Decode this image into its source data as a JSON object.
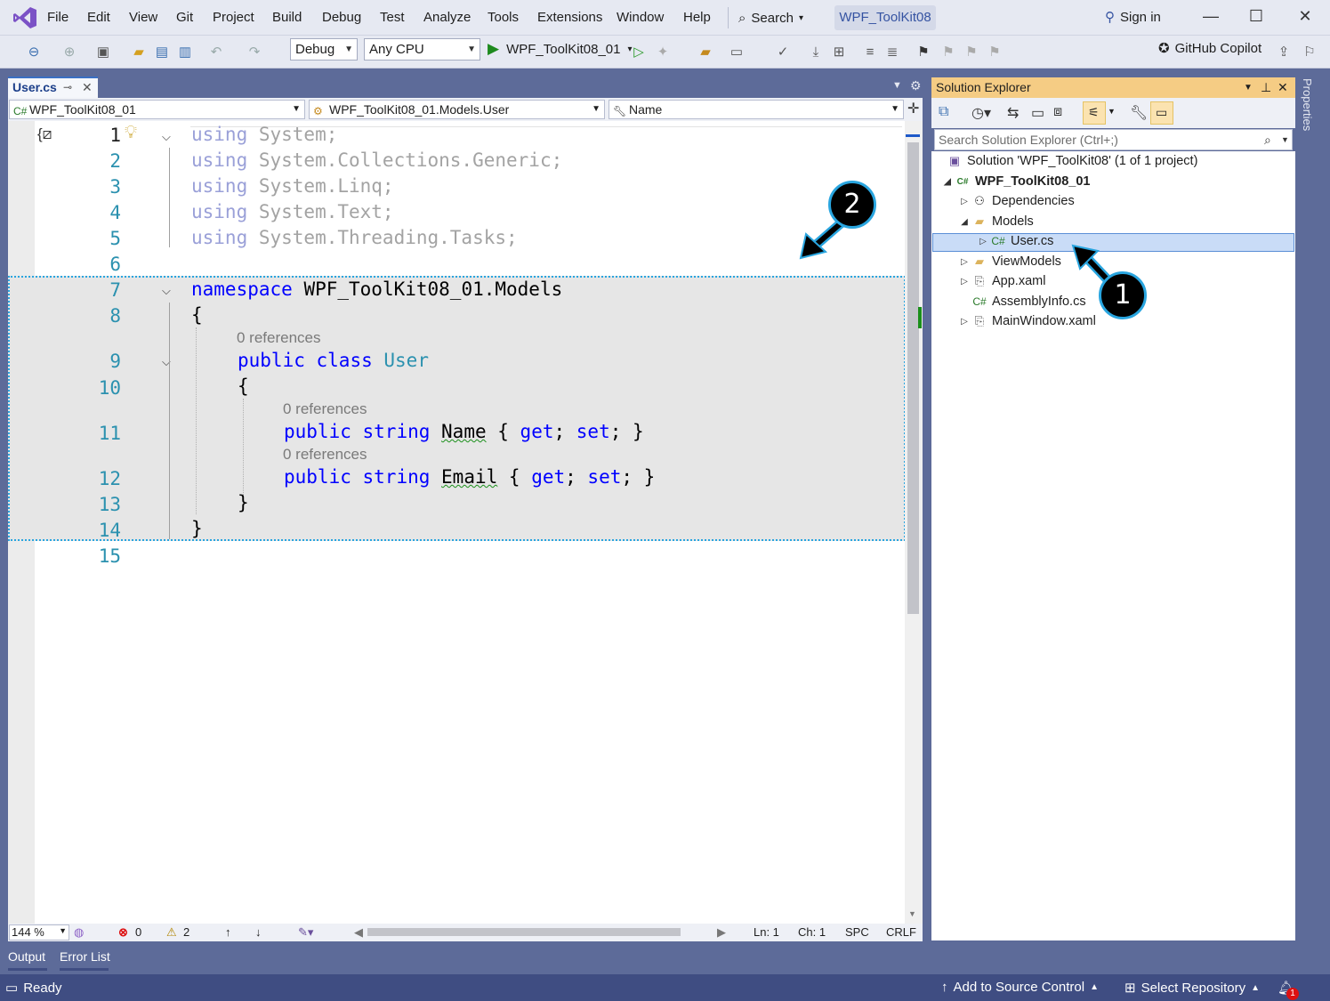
{
  "menu": [
    "File",
    "Edit",
    "View",
    "Git",
    "Project",
    "Build",
    "Debug",
    "Test",
    "Analyze",
    "Tools",
    "Extensions",
    "Window",
    "Help"
  ],
  "search_label": "Search",
  "window_title": "WPF_ToolKit08",
  "sign_in": "Sign in",
  "toolbar": {
    "config": "Debug",
    "platform": "Any CPU",
    "run_target": "WPF_ToolKit08_01",
    "copilot": "GitHub Copilot"
  },
  "doc_tab": "User.cs",
  "nav": {
    "project": "WPF_ToolKit08_01",
    "type": "WPF_ToolKit08_01.Models.User",
    "member": "Name"
  },
  "editor": {
    "line_numbers": [
      "1",
      "2",
      "3",
      "4",
      "5",
      "6",
      "7",
      "8",
      "9",
      "10",
      "11",
      "12",
      "13",
      "14",
      "15"
    ],
    "code": {
      "l1_kw": "using",
      "l1_rest": " System;",
      "l2_kw": "using",
      "l2_rest": " System.Collections.Generic;",
      "l3_kw": "using",
      "l3_rest": " System.Linq;",
      "l4_kw": "using",
      "l4_rest": " System.Text;",
      "l5_kw": "using",
      "l5_rest": " System.Threading.Tasks;",
      "l7_kw": "namespace",
      "l7_rest": " WPF_ToolKit08_01.Models",
      "l8": "{",
      "l9_kw1": "public",
      "l9_kw2": "class",
      "l9_type": "User",
      "l10": "{",
      "l11_kw1": "public",
      "l11_kw2": "string",
      "l11_name": "Name",
      "l11_b1": " { ",
      "l11_get": "get",
      "l11_s1": "; ",
      "l11_set": "set",
      "l11_b2": "; }",
      "l12_kw1": "public",
      "l12_kw2": "string",
      "l12_name": "Email",
      "l12_b1": " { ",
      "l12_get": "get",
      "l12_s1": "; ",
      "l12_set": "set",
      "l12_b2": "; }",
      "l13": "}",
      "l14": "}"
    },
    "codelens": "0 references",
    "zoom": "144 %",
    "errors": "0",
    "warnings": "2",
    "ln": "Ln: 1",
    "ch": "Ch: 1",
    "spc": "SPC",
    "crlf": "CRLF"
  },
  "solution_explorer": {
    "title": "Solution Explorer",
    "search_placeholder": "Search Solution Explorer (Ctrl+;)",
    "solution": "Solution 'WPF_ToolKit08' (1 of 1 project)",
    "project": "WPF_ToolKit08_01",
    "items": [
      "Dependencies",
      "Models",
      "User.cs",
      "ViewModels",
      "App.xaml",
      "AssemblyInfo.cs",
      "MainWindow.xaml"
    ],
    "properties_tab": "Properties"
  },
  "bottom_tabs": [
    "Output",
    "Error List"
  ],
  "status": {
    "ready": "Ready",
    "add_source": "Add to Source Control",
    "select_repo": "Select Repository",
    "notifications": "1"
  },
  "callouts": [
    "1",
    "2"
  ],
  "colors": {
    "accent": "#29a5df",
    "chrome": "#5d6b99",
    "keyword": "#0000ff",
    "type": "#2b91af"
  }
}
